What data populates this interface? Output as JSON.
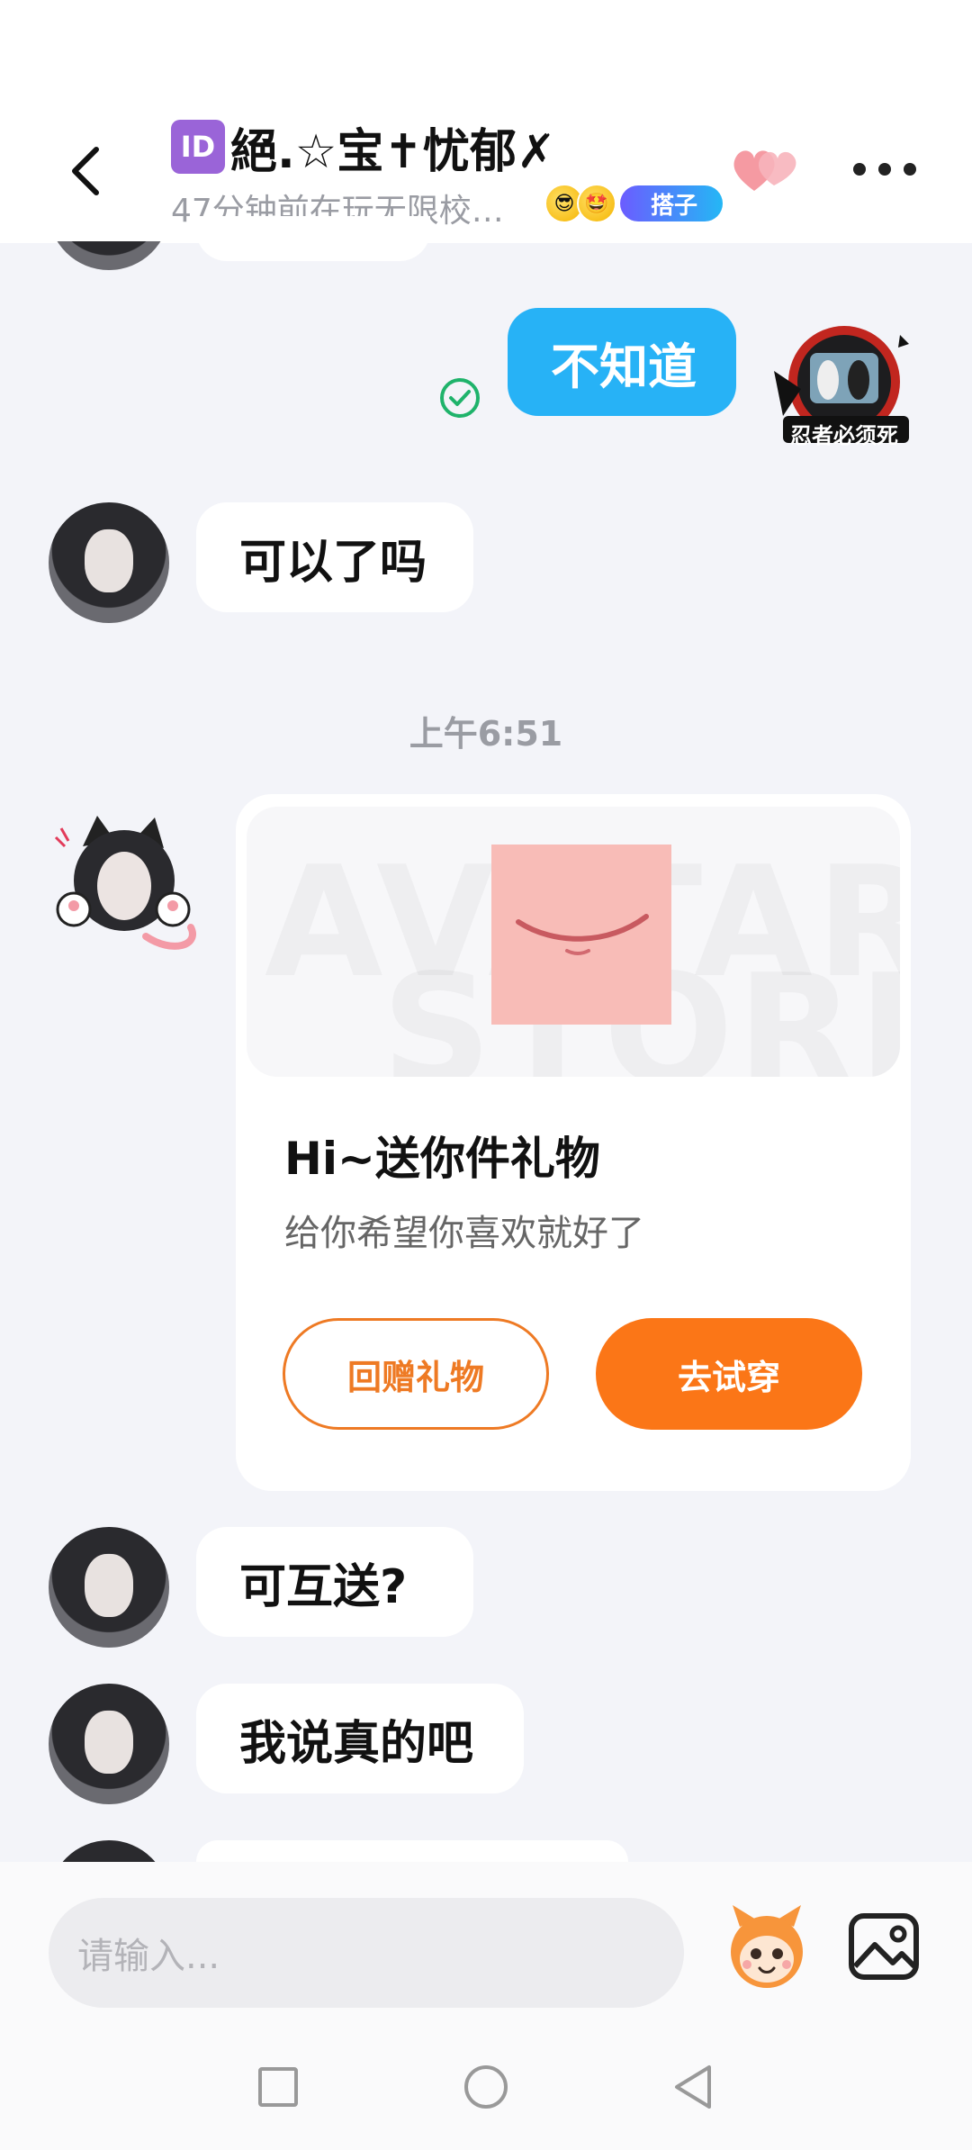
{
  "header": {
    "id_badge": "ID",
    "title": "絕.☆宝✝忧郁✗",
    "subtitle": "47分钟前在玩无限校…",
    "tag": "搭子",
    "colors": {
      "tag_gradient_start": "#6b5cff",
      "tag_gradient_end": "#24b7f5"
    }
  },
  "messages": {
    "mine": {
      "text": "不知道",
      "color": "#27b2f6"
    },
    "m1": "可以了吗",
    "timestamp": "上午6:51",
    "m2": "可互送?",
    "m3": "我说真的吧"
  },
  "gift_card": {
    "watermark_line1": "AVATAR",
    "watermark_line2": "STORE",
    "title": "Hi~送你件礼物",
    "description": "给你希望你喜欢就好了",
    "return_label": "回赠礼物",
    "try_label": "去试穿",
    "accent": "#fb7617"
  },
  "input": {
    "placeholder": "请输入..."
  },
  "my_avatar": {
    "caption": "忍者必须死"
  }
}
